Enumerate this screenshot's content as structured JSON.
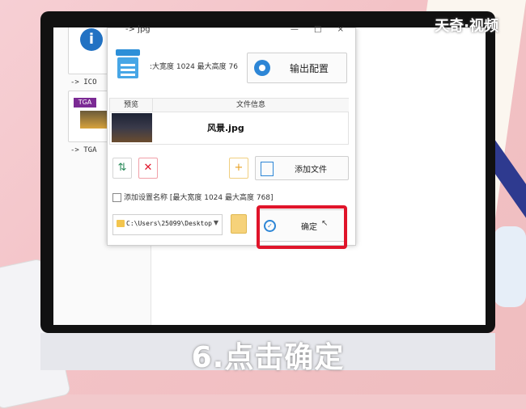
{
  "watermark": "天奇·视频",
  "caption": "6.点击确定",
  "background_window": {
    "items": [
      {
        "label": "-> ICO",
        "badge": "i"
      },
      {
        "label": "-> TGA",
        "badge": "TGA"
      }
    ]
  },
  "dialog": {
    "title": "-> jpg",
    "window_controls": "— □ ×",
    "size_text": ":大宽度 1024 最大高度 76",
    "output_config_label": "输出配置",
    "table": {
      "col_preview": "预览",
      "col_info": "文件信息",
      "rows": [
        {
          "file": "风景.jpg"
        }
      ]
    },
    "add_file_label": "添加文件",
    "checkbox_label": "添加设置名称 [最大宽度 1024 最大高度 768]",
    "path": "C:\\Users\\25099\\Desktop",
    "confirm_label": "确定"
  },
  "colors": {
    "accent": "#2d86d6",
    "highlight": "#e0142a"
  }
}
